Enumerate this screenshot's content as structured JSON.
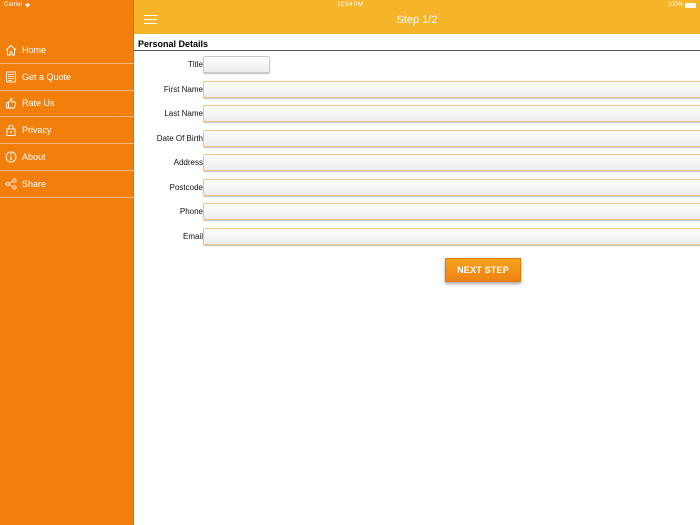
{
  "status_bar": {
    "carrier": "Carrier",
    "time": "12:54 PM",
    "battery": "100%"
  },
  "header": {
    "title": "Step 1/2"
  },
  "sidebar": {
    "items": [
      {
        "label": "Home",
        "icon": "home-icon"
      },
      {
        "label": "Get a Quote",
        "icon": "quote-icon"
      },
      {
        "label": "Rate Us",
        "icon": "thumbs-up-icon"
      },
      {
        "label": "Privacy",
        "icon": "lock-icon"
      },
      {
        "label": "About",
        "icon": "info-icon"
      },
      {
        "label": "Share",
        "icon": "share-icon"
      }
    ]
  },
  "form": {
    "section_title": "Personal Details",
    "fields": [
      {
        "label": "Title",
        "value": ""
      },
      {
        "label": "First Name",
        "value": ""
      },
      {
        "label": "Last Name",
        "value": ""
      },
      {
        "label": "Date Of Birth",
        "value": ""
      },
      {
        "label": "Address",
        "value": ""
      },
      {
        "label": "Postcode",
        "value": ""
      },
      {
        "label": "Phone",
        "value": ""
      },
      {
        "label": "Email",
        "value": ""
      }
    ],
    "next_label": "NEXT STEP"
  },
  "colors": {
    "sidebar": "#f27f0c",
    "header": "#f5b42a",
    "button": "#f39317"
  }
}
